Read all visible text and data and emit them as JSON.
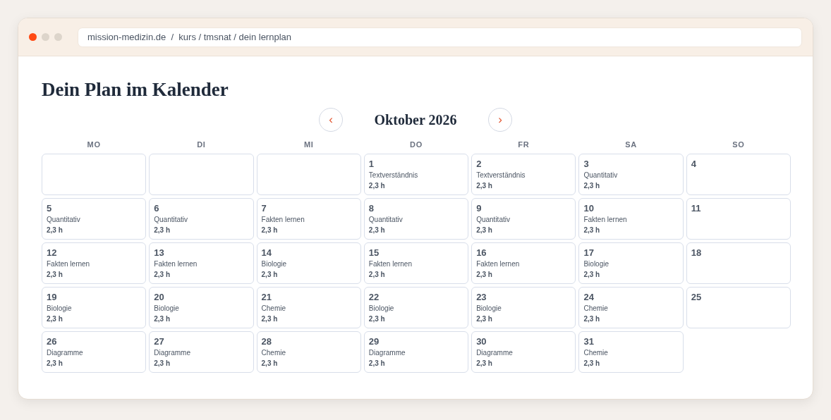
{
  "browser": {
    "address": "mission-medizin.de  /  kurs / tmsnat / dein lernplan"
  },
  "page": {
    "title": "Dein Plan im Kalender"
  },
  "calendar": {
    "month": "Oktober 2026",
    "prev": "‹",
    "next": "›",
    "weekdays": [
      "MO",
      "DI",
      "MI",
      "DO",
      "FR",
      "SA",
      "SO"
    ],
    "days": [
      {
        "kind": "blank"
      },
      {
        "kind": "blank"
      },
      {
        "kind": "blank"
      },
      {
        "kind": "day",
        "date": "1",
        "topic": "Textverständnis",
        "hours": "2,3 h"
      },
      {
        "kind": "day",
        "date": "2",
        "topic": "Textverständnis",
        "hours": "2,3 h"
      },
      {
        "kind": "day",
        "date": "3",
        "topic": "Quantitativ",
        "hours": "2,3 h"
      },
      {
        "kind": "day",
        "date": "4"
      },
      {
        "kind": "day",
        "date": "5",
        "topic": "Quantitativ",
        "hours": "2,3 h"
      },
      {
        "kind": "day",
        "date": "6",
        "topic": "Quantitativ",
        "hours": "2,3 h"
      },
      {
        "kind": "day",
        "date": "7",
        "topic": "Fakten lernen",
        "hours": "2,3 h"
      },
      {
        "kind": "day",
        "date": "8",
        "topic": "Quantitativ",
        "hours": "2,3 h"
      },
      {
        "kind": "day",
        "date": "9",
        "topic": "Quantitativ",
        "hours": "2,3 h"
      },
      {
        "kind": "day",
        "date": "10",
        "topic": "Fakten lernen",
        "hours": "2,3 h"
      },
      {
        "kind": "day",
        "date": "11"
      },
      {
        "kind": "day",
        "date": "12",
        "topic": "Fakten lernen",
        "hours": "2,3 h"
      },
      {
        "kind": "day",
        "date": "13",
        "topic": "Fakten lernen",
        "hours": "2,3 h"
      },
      {
        "kind": "day",
        "date": "14",
        "topic": "Biologie",
        "hours": "2,3 h"
      },
      {
        "kind": "day",
        "date": "15",
        "topic": "Fakten lernen",
        "hours": "2,3 h"
      },
      {
        "kind": "day",
        "date": "16",
        "topic": "Fakten lernen",
        "hours": "2,3 h"
      },
      {
        "kind": "day",
        "date": "17",
        "topic": "Biologie",
        "hours": "2,3 h"
      },
      {
        "kind": "day",
        "date": "18"
      },
      {
        "kind": "day",
        "date": "19",
        "topic": "Biologie",
        "hours": "2,3 h"
      },
      {
        "kind": "day",
        "date": "20",
        "topic": "Biologie",
        "hours": "2,3 h"
      },
      {
        "kind": "day",
        "date": "21",
        "topic": "Chemie",
        "hours": "2,3 h"
      },
      {
        "kind": "day",
        "date": "22",
        "topic": "Biologie",
        "hours": "2,3 h"
      },
      {
        "kind": "day",
        "date": "23",
        "topic": "Biologie",
        "hours": "2,3 h"
      },
      {
        "kind": "day",
        "date": "24",
        "topic": "Chemie",
        "hours": "2,3 h"
      },
      {
        "kind": "day",
        "date": "25"
      },
      {
        "kind": "day",
        "date": "26",
        "topic": "Diagramme",
        "hours": "2,3 h"
      },
      {
        "kind": "day",
        "date": "27",
        "topic": "Diagramme",
        "hours": "2,3 h"
      },
      {
        "kind": "day",
        "date": "28",
        "topic": "Chemie",
        "hours": "2,3 h"
      },
      {
        "kind": "day",
        "date": "29",
        "topic": "Diagramme",
        "hours": "2,3 h"
      },
      {
        "kind": "day",
        "date": "30",
        "topic": "Diagramme",
        "hours": "2,3 h"
      },
      {
        "kind": "day",
        "date": "31",
        "topic": "Chemie",
        "hours": "2,3 h"
      }
    ]
  }
}
